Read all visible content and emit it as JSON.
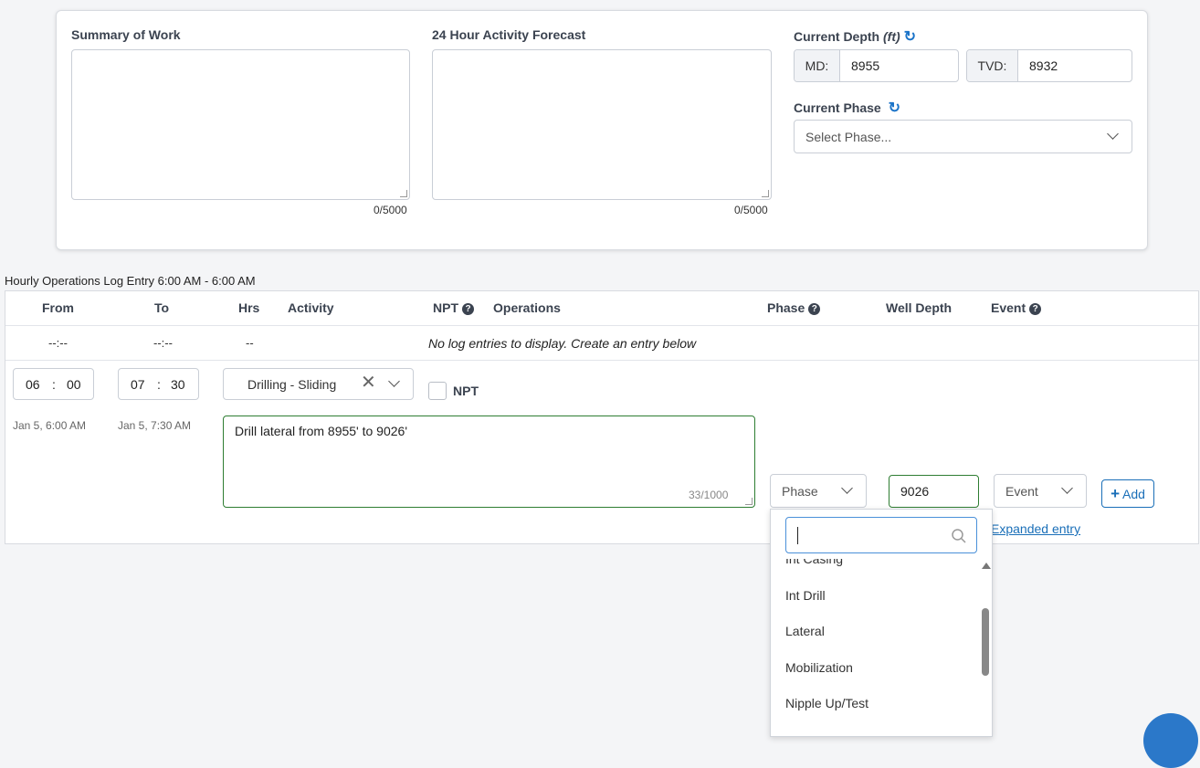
{
  "summary": {
    "label": "Summary of Work",
    "counter": "0/5000",
    "value": ""
  },
  "forecast": {
    "label": "24 Hour Activity Forecast",
    "counter": "0/5000",
    "value": ""
  },
  "depth": {
    "label": "Current Depth",
    "unit": "(ft)",
    "md_label": "MD:",
    "md_value": "8955",
    "tvd_label": "TVD:",
    "tvd_value": "8932"
  },
  "phase": {
    "label": "Current Phase",
    "placeholder": "Select Phase..."
  },
  "log": {
    "title": "Hourly Operations Log Entry 6:00 AM - 6:00 AM",
    "headers": {
      "from": "From",
      "to": "To",
      "hrs": "Hrs",
      "activity": "Activity",
      "npt": "NPT",
      "operations": "Operations",
      "phase": "Phase",
      "well_depth": "Well Depth",
      "event": "Event"
    },
    "empty_row": {
      "from": "--:--",
      "to": "--:--",
      "hrs": "--",
      "message": "No log entries to display. Create an entry below"
    }
  },
  "entry": {
    "from_hh": "06",
    "from_mm": "00",
    "from_date": "Jan 5, 6:00 AM",
    "to_hh": "07",
    "to_mm": "30",
    "to_date": "Jan 5, 7:30 AM",
    "separator": ":",
    "activity": "Drilling - Sliding",
    "npt_label": "NPT",
    "operations": "Drill lateral from 8955' to 9026'",
    "operations_counter": "33/1000",
    "phase_placeholder": "Phase",
    "well_depth": "9026",
    "event_placeholder": "Event",
    "add_label": "Add",
    "expanded_link": "Expanded entry"
  },
  "phase_dropdown": {
    "search_value": "",
    "items": [
      "Int Casing",
      "Int Drill",
      "Lateral",
      "Mobilization",
      "Nipple Up/Test"
    ]
  }
}
